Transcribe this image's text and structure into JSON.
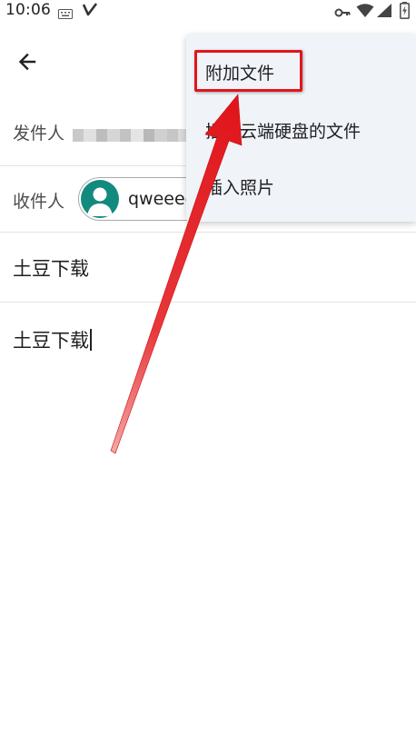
{
  "status_bar": {
    "time": "10:06",
    "icons": [
      "keyboard-icon",
      "v-app-icon",
      "vpn-key-icon",
      "wifi-icon",
      "signal-icon",
      "battery-charging-icon"
    ]
  },
  "app_bar": {
    "back_icon": "arrow-back-icon"
  },
  "compose": {
    "from_label": "发件人",
    "to_label": "收件人",
    "recipient_name": "qweeee",
    "subject": "土豆下载",
    "body": "土豆下载"
  },
  "menu": {
    "items": [
      {
        "label": "附加文件"
      },
      {
        "label": "插入云端硬盘的文件"
      },
      {
        "label": "插入照片"
      }
    ]
  },
  "colors": {
    "avatar_bg": "#138a7e",
    "menu_bg": "#f0f3f8",
    "annotation_red": "#e0151b"
  }
}
